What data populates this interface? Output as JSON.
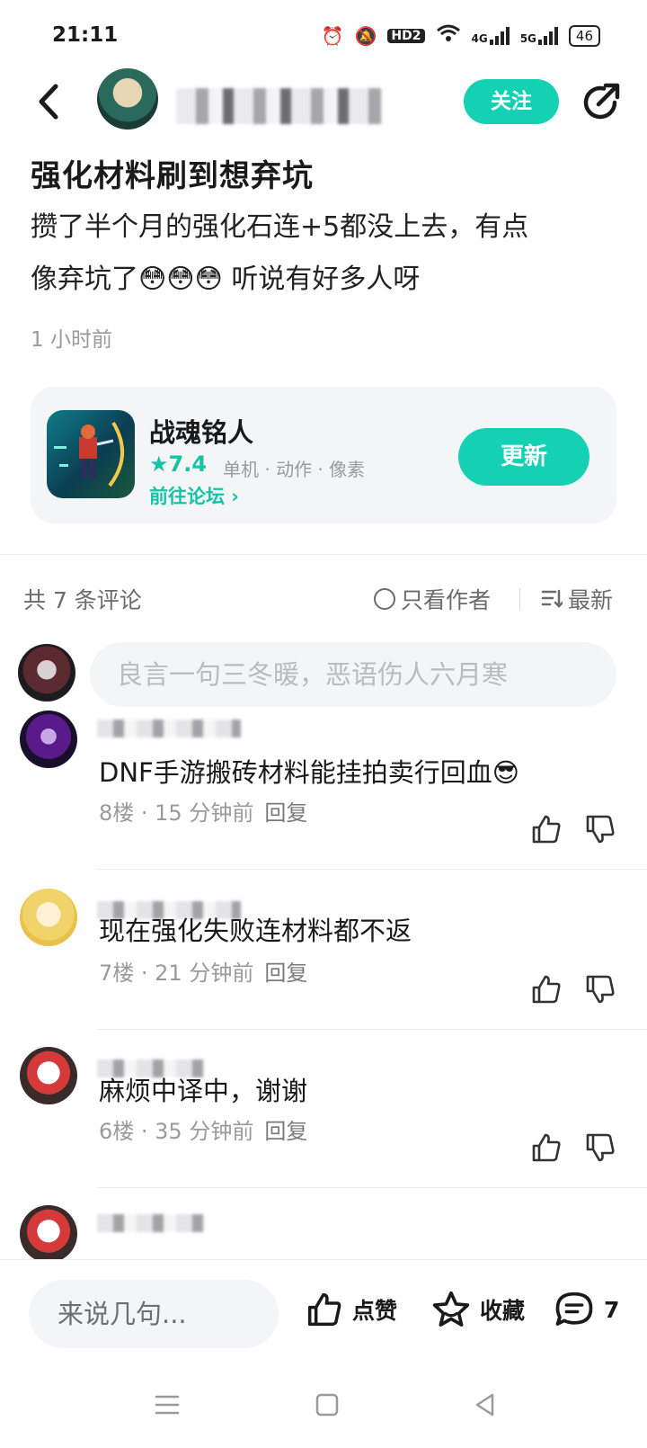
{
  "status_bar": {
    "time": "21:11",
    "hd_label": "HD2",
    "net4g": "4G",
    "net5g": "5G",
    "battery": "46"
  },
  "header": {
    "follow_label": "关注"
  },
  "post": {
    "title": "强化材料刷到想弃坑",
    "content_line1": "攒了半个月的强化石连+5都没上去，有点",
    "content_line2": "像弃坑了😳😳😳  听说有好多人呀",
    "time": "1 小时前"
  },
  "game_card": {
    "name": "战魂铭人",
    "rating": "★7.4",
    "tags": "单机 · 动作 · 像素",
    "forum_link": "前往论坛 ›",
    "update_label": "更新"
  },
  "comments_bar": {
    "count_label": "共 7 条评论",
    "only_author_label": "只看作者",
    "sort_label": "最新",
    "input_placeholder": "良言一句三冬暖，恶语伤人六月寒"
  },
  "comments": [
    {
      "text": "DNF手游搬砖材料能挂拍卖行回血😎",
      "floor": "8楼 · 15 分钟前",
      "reply": "回复"
    },
    {
      "text": "现在强化失败连材料都不返",
      "floor": "7楼 · 21 分钟前",
      "reply": "回复"
    },
    {
      "text": "麻烦中译中，谢谢",
      "floor": "6楼 · 35 分钟前",
      "reply": "回复"
    }
  ],
  "bottom_bar": {
    "input_placeholder": "来说几句...",
    "like_label": "点赞",
    "fav_label": "收藏",
    "comment_count": "7"
  },
  "colors": {
    "accent": "#15d1b3",
    "accent_text": "#15c4a8",
    "muted": "#9a9a9a",
    "card_bg": "#f3f5f6"
  }
}
